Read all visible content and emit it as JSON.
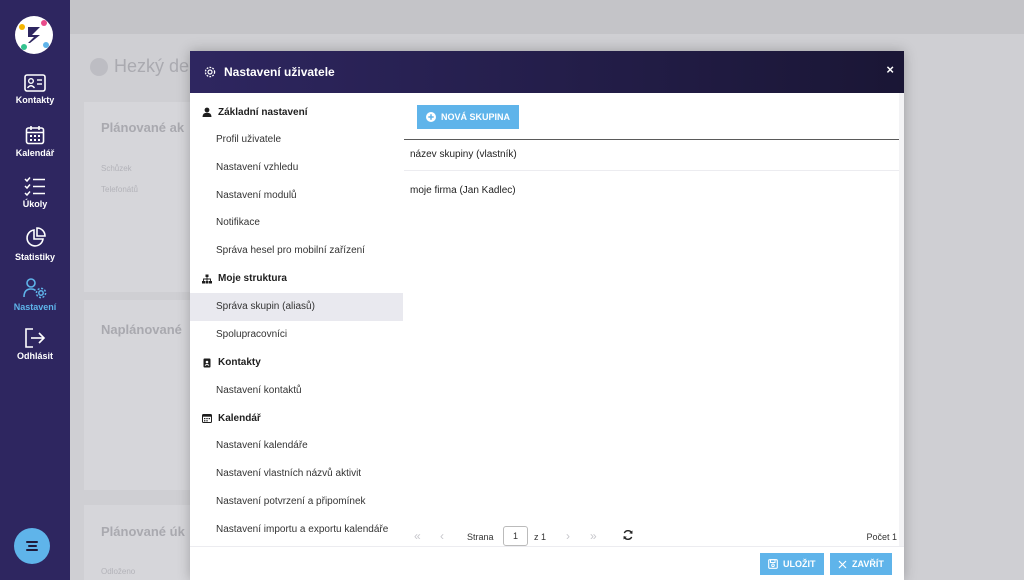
{
  "app_nav": [
    {
      "label": "Kontakty",
      "icon": "contact-card-icon"
    },
    {
      "label": "Kalendář",
      "icon": "calendar-icon"
    },
    {
      "label": "Úkoly",
      "icon": "checklist-icon"
    },
    {
      "label": "Statistiky",
      "icon": "pie-chart-icon"
    },
    {
      "label": "Nastavení",
      "icon": "users-gear-icon",
      "active": true
    },
    {
      "label": "Odhlásit",
      "icon": "logout-icon"
    }
  ],
  "background": {
    "header": "Hezký de",
    "card1_title": "Plánované ak",
    "card1_line1": "Schůzek",
    "card1_line2": "Telefonátů",
    "card2_title": "Naplánované",
    "card3_title": "Plánované úk",
    "card3_line1": "Odloženo"
  },
  "modal": {
    "title": "Nastavení uživatele",
    "close_label": "×",
    "nav": {
      "sections": [
        {
          "label": "Základní nastavení",
          "icon": "user-icon",
          "items": [
            "Profil uživatele",
            "Nastavení vzhledu",
            "Nastavení modulů",
            "Notifikace",
            "Správa hesel pro mobilní zařízení"
          ]
        },
        {
          "label": "Moje struktura",
          "icon": "sitemap-icon",
          "items": [
            "Správa skupin (aliasů)",
            "Spolupracovníci"
          ]
        },
        {
          "label": "Kontakty",
          "icon": "address-book-icon",
          "items": [
            "Nastavení kontaktů"
          ]
        },
        {
          "label": "Kalendář",
          "icon": "calendar-small-icon",
          "items": [
            "Nastavení kalendáře",
            "Nastavení vlastních názvů aktivit",
            "Nastavení potvrzení a připomínek",
            "Nastavení importu a exportu kalendáře"
          ]
        }
      ],
      "active_item": "Správa skupin (aliasů)"
    },
    "main": {
      "new_group_button": "NOVÁ SKUPINA",
      "column_header": "název skupiny (vlastník)",
      "rows": [
        "moje firma (Jan Kadlec)"
      ]
    },
    "pager": {
      "page_label": "Strana",
      "page_value": "1",
      "of_label": "z 1",
      "count_label": "Počet 1"
    },
    "footer": {
      "save_label": "ULOŽIT",
      "close_label": "ZAVŘÍT"
    }
  },
  "colors": {
    "sidebar": "#2e2660",
    "accent": "#5fb4ea",
    "header_dark": "#1a1635"
  }
}
